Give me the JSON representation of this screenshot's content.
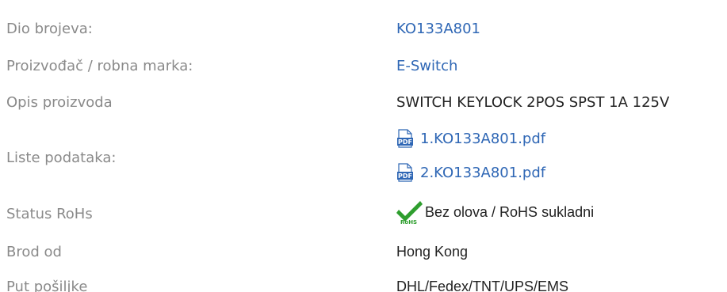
{
  "rows": {
    "part_number": {
      "label": "Dio brojeva:",
      "value": "KO133A801"
    },
    "manufacturer": {
      "label": "Proizvođač / robna marka:",
      "value": "E-Switch"
    },
    "description": {
      "label": "Opis proizvoda",
      "value": "SWITCH KEYLOCK 2POS SPST 1A 125V"
    },
    "datasheets": {
      "label": "Liste podataka:",
      "files": [
        {
          "name": "1.KO133A801.pdf",
          "icon": "pdf-icon"
        },
        {
          "name": "2.KO133A801.pdf",
          "icon": "pdf-icon"
        }
      ]
    },
    "rohs": {
      "label": "Status RoHs",
      "icon": "rohs-check-icon",
      "value": "Bez olova / RoHS sukladni"
    },
    "ship_from": {
      "label": "Brod od",
      "value": "Hong Kong"
    },
    "shipping": {
      "label": "Put pošiljke",
      "value": "DHL/Fedex/TNT/UPS/EMS"
    }
  },
  "colors": {
    "label": "#8a8a8a",
    "link": "#2f67b5",
    "text": "#222222",
    "pdf_icon": "#2f67b5",
    "rohs_check": "#2e9e2e"
  }
}
